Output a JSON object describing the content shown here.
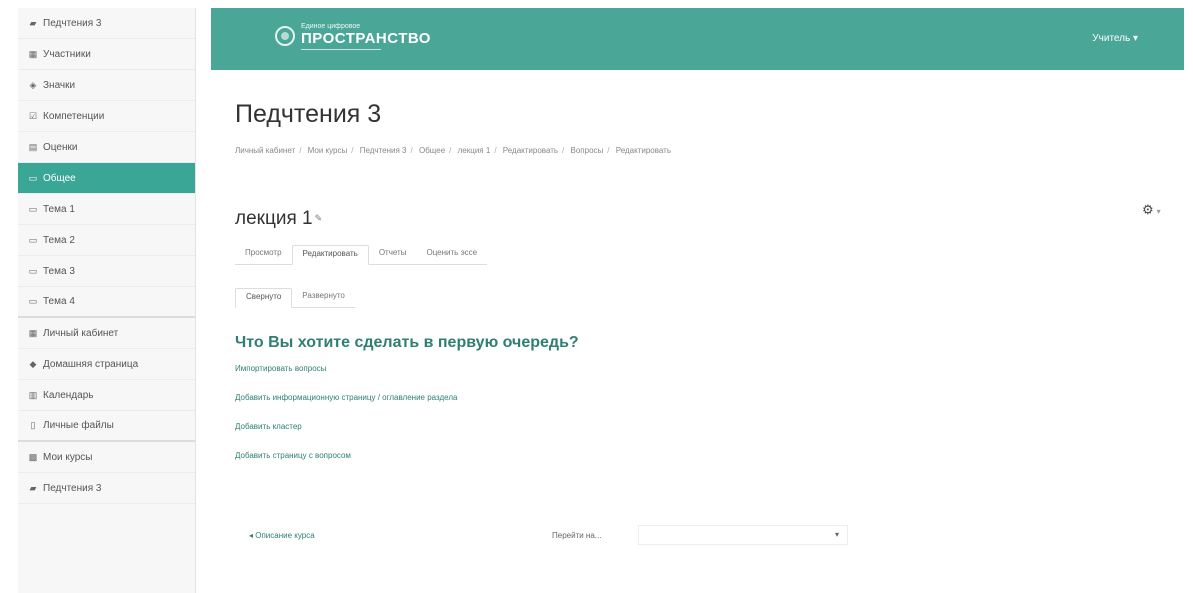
{
  "sidebar": {
    "items": [
      {
        "icon": "▰",
        "label": "Педчтения 3"
      },
      {
        "icon": "▦",
        "label": "Участники"
      },
      {
        "icon": "◈",
        "label": "Значки"
      },
      {
        "icon": "☑",
        "label": "Компетенции"
      },
      {
        "icon": "▤",
        "label": "Оценки"
      },
      {
        "icon": "▭",
        "label": "Общее"
      },
      {
        "icon": "▭",
        "label": "Тема 1"
      },
      {
        "icon": "▭",
        "label": "Тема 2"
      },
      {
        "icon": "▭",
        "label": "Тема 3"
      },
      {
        "icon": "▭",
        "label": "Тема 4"
      },
      {
        "icon": "▦",
        "label": "Личный кабинет"
      },
      {
        "icon": "◆",
        "label": "Домашняя страница"
      },
      {
        "icon": "▥",
        "label": "Календарь"
      },
      {
        "icon": "▯",
        "label": "Личные файлы"
      },
      {
        "icon": "▩",
        "label": "Мои курсы"
      },
      {
        "icon": "▰",
        "label": "Педчтения 3"
      }
    ]
  },
  "header": {
    "logo_small": "Единое цифровое",
    "logo_big": "ПРОСТРАНСТВО",
    "user_menu": "Учитель ▾"
  },
  "page": {
    "title": "Педчтения 3",
    "breadcrumb": [
      "Личный кабинет",
      "Мои курсы",
      "Педчтения 3",
      "Общее",
      "лекция 1",
      "Редактировать",
      "Вопросы",
      "Редактировать"
    ]
  },
  "module": {
    "title": "лекция 1",
    "ext_marker": "✎",
    "gear": "⚙",
    "gear_caret": "▾"
  },
  "tabs": [
    "Просмотр",
    "Редактировать",
    "Отчеты",
    "Оценить эссе"
  ],
  "active_tab": 1,
  "subtabs": [
    "Свернуто",
    "Развернуто"
  ],
  "active_subtab": 0,
  "question": "Что Вы хотите сделать в первую очередь?",
  "actions": [
    "Импортировать вопросы",
    "Добавить информационную страницу / оглавление раздела",
    "Добавить кластер",
    "Добавить страницу с вопросом"
  ],
  "footer": {
    "prev_link": "◂ Описание курса",
    "jump_label": "Перейти на...",
    "jump_arrow": "▾"
  }
}
